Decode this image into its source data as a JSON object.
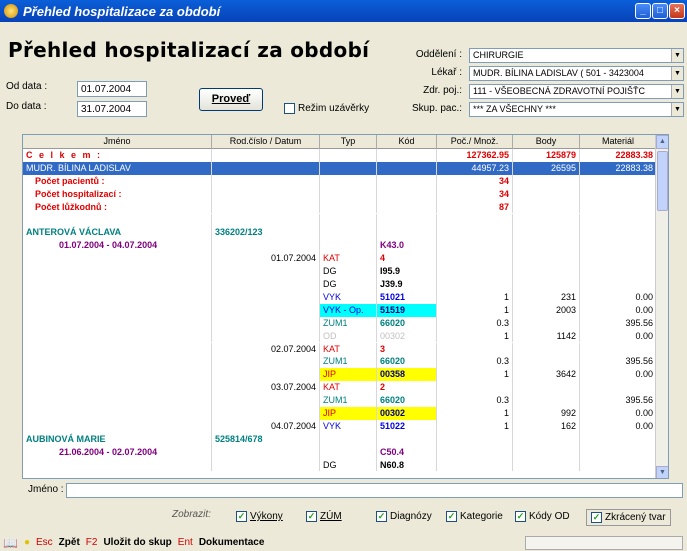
{
  "window": {
    "title": "Přehled hospitalizace za období"
  },
  "main_title": "Přehled hospitalizací za období",
  "form": {
    "od_label": "Od data :",
    "od_value": "01.07.2004",
    "do_label": "Do data :",
    "do_value": "31.07.2004",
    "run_button": "Proveď",
    "rezim_label": "Režim uzávěrky",
    "oddeleni_label": "Oddělení :",
    "oddeleni_value": "CHIRURGIE",
    "lekar_label": "Lékař :",
    "lekar_value": "MUDR. BÍLINA LADISLAV ( 501 - 3423004",
    "zdrpoj_label": "Zdr. poj.:",
    "zdrpoj_value": "111 - VŠEOBECNÁ ZDRAVOTNÍ POJIŠŤC",
    "skup_label": "Skup. pac.:",
    "skup_value": "*** ZA VŠECHNY ***"
  },
  "columns": [
    "Jméno",
    "Rod.číslo / Datum",
    "Typ",
    "Kód",
    "Poč./ Množ.",
    "Body",
    "Materiál"
  ],
  "rows": [
    {
      "name": "C e l k e m :",
      "rc": "",
      "typ": "",
      "kod": "",
      "poc": "127362.95",
      "body": "125879",
      "mat": "22883.38",
      "style": "total"
    },
    {
      "name": "MUDR. BÍLINA LADISLAV",
      "rc": "",
      "typ": "",
      "kod": "",
      "poc": "44957.23",
      "body": "26595",
      "mat": "22883.38",
      "style": "selected"
    },
    {
      "name": "Počet pacientů :",
      "rc": "",
      "typ": "",
      "kod": "",
      "poc": "34",
      "body": "",
      "mat": "",
      "style": "stat"
    },
    {
      "name": "Počet hospitalizací :",
      "rc": "",
      "typ": "",
      "kod": "",
      "poc": "34",
      "body": "",
      "mat": "",
      "style": "stat"
    },
    {
      "name": "Počet lůžkodnů :",
      "rc": "",
      "typ": "",
      "kod": "",
      "poc": "87",
      "body": "",
      "mat": "",
      "style": "stat"
    },
    {
      "name": "",
      "rc": "",
      "typ": "",
      "kod": "",
      "poc": "",
      "body": "",
      "mat": "",
      "style": "blank"
    },
    {
      "name": "ANTEROVÁ VÁCLAVA",
      "rc": "336202/123",
      "typ": "",
      "kod": "",
      "poc": "",
      "body": "",
      "mat": "",
      "style": "patient"
    },
    {
      "name": "01.07.2004 - 04.07.2004",
      "rc": "",
      "typ": "",
      "kod": "K43.0",
      "poc": "",
      "body": "",
      "mat": "",
      "style": "period"
    },
    {
      "name": "",
      "rc": "01.07.2004",
      "typ": "KAT",
      "kod": "4",
      "poc": "",
      "body": "",
      "mat": "",
      "style": "kat"
    },
    {
      "name": "",
      "rc": "",
      "typ": "DG",
      "kod": "I95.9",
      "poc": "",
      "body": "",
      "mat": "",
      "style": "dg"
    },
    {
      "name": "",
      "rc": "",
      "typ": "DG",
      "kod": "J39.9",
      "poc": "",
      "body": "",
      "mat": "",
      "style": "dg"
    },
    {
      "name": "",
      "rc": "",
      "typ": "VYK",
      "kod": "51021",
      "poc": "1",
      "body": "231",
      "mat": "0.00",
      "style": "vyk"
    },
    {
      "name": "",
      "rc": "",
      "typ": "VYK - Op.",
      "kod": "51519",
      "poc": "1",
      "body": "2003",
      "mat": "0.00",
      "style": "vykop"
    },
    {
      "name": "",
      "rc": "",
      "typ": "ZUM1",
      "kod": "66020",
      "poc": "0.3",
      "body": "",
      "mat": "395.56",
      "style": "zum"
    },
    {
      "name": "",
      "rc": "",
      "typ": "OD",
      "kod": "00302",
      "poc": "1",
      "body": "1142",
      "mat": "0.00",
      "style": "od"
    },
    {
      "name": "",
      "rc": "02.07.2004",
      "typ": "KAT",
      "kod": "3",
      "poc": "",
      "body": "",
      "mat": "",
      "style": "kat"
    },
    {
      "name": "",
      "rc": "",
      "typ": "ZUM1",
      "kod": "66020",
      "poc": "0.3",
      "body": "",
      "mat": "395.56",
      "style": "zum"
    },
    {
      "name": "",
      "rc": "",
      "typ": "JIP",
      "kod": "00358",
      "poc": "1",
      "body": "3642",
      "mat": "0.00",
      "style": "jip"
    },
    {
      "name": "",
      "rc": "03.07.2004",
      "typ": "KAT",
      "kod": "2",
      "poc": "",
      "body": "",
      "mat": "",
      "style": "kat"
    },
    {
      "name": "",
      "rc": "",
      "typ": "ZUM1",
      "kod": "66020",
      "poc": "0.3",
      "body": "",
      "mat": "395.56",
      "style": "zum"
    },
    {
      "name": "",
      "rc": "",
      "typ": "JIP",
      "kod": "00302",
      "poc": "1",
      "body": "992",
      "mat": "0.00",
      "style": "jip"
    },
    {
      "name": "",
      "rc": "04.07.2004",
      "typ": "VYK",
      "kod": "51022",
      "poc": "1",
      "body": "162",
      "mat": "0.00",
      "style": "vyk"
    },
    {
      "name": "AUBINOVÁ MARIE",
      "rc": "525814/678",
      "typ": "",
      "kod": "",
      "poc": "",
      "body": "",
      "mat": "",
      "style": "patient"
    },
    {
      "name": "21.06.2004 - 02.07.2004",
      "rc": "",
      "typ": "",
      "kod": "C50.4",
      "poc": "",
      "body": "",
      "mat": "",
      "style": "period"
    },
    {
      "name": "",
      "rc": "",
      "typ": "DG",
      "kod": "N60.8",
      "poc": "",
      "body": "",
      "mat": "",
      "style": "dg"
    }
  ],
  "jmeno_label": "Jméno :",
  "filters": {
    "zobrazit": "Zobrazit:",
    "vykony": "Výkony",
    "zum": "ZÚM",
    "diagnozy": "Diagnózy",
    "kategorie": "Kategorie",
    "kody_od": "Kódy OD",
    "zkraceny": "Zkrácený tvar"
  },
  "status": {
    "esc_key": "Esc",
    "esc_label": "Zpět",
    "f2_key": "F2",
    "f2_label": "Uložit do skup",
    "ent_key": "Ent",
    "ent_label": "Dokumentace"
  },
  "colors": {
    "total": "#e00000",
    "patient": "#008080",
    "period": "#800080",
    "kat": "#e00000",
    "dg": "#000000",
    "vyk": "#0000e0",
    "zum": "#008080",
    "od": "#c0c0c0",
    "jip_bg": "#ffff00",
    "vykop_bg": "#00ffff"
  }
}
